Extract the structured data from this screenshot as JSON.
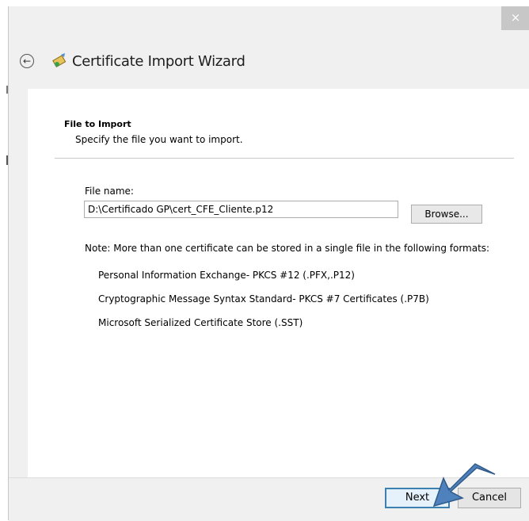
{
  "window": {
    "title": "Certificate Import Wizard",
    "close_glyph": "×"
  },
  "header": {
    "back_icon": "back-arrow-icon",
    "wizard_icon": "certificate-icon",
    "title": "Certificate Import Wizard"
  },
  "section": {
    "title": "File to Import",
    "subtitle": "Specify the file you want to import."
  },
  "file": {
    "label": "File name:",
    "value": "D:\\Certificado GP\\cert_CFE_Cliente.p12",
    "browse_label": "Browse..."
  },
  "note": {
    "text": "Note:  More than one certificate can be stored in a single file in the following formats:",
    "formats": [
      "Personal Information Exchange- PKCS #12 (.PFX,.P12)",
      "Cryptographic Message Syntax Standard- PKCS #7 Certificates (.P7B)",
      "Microsoft Serialized Certificate Store (.SST)"
    ]
  },
  "footer": {
    "next_label": "Next",
    "cancel_label": "Cancel"
  },
  "colors": {
    "accent": "#3c7fb1",
    "annotation_arrow": "#4f81bd"
  }
}
